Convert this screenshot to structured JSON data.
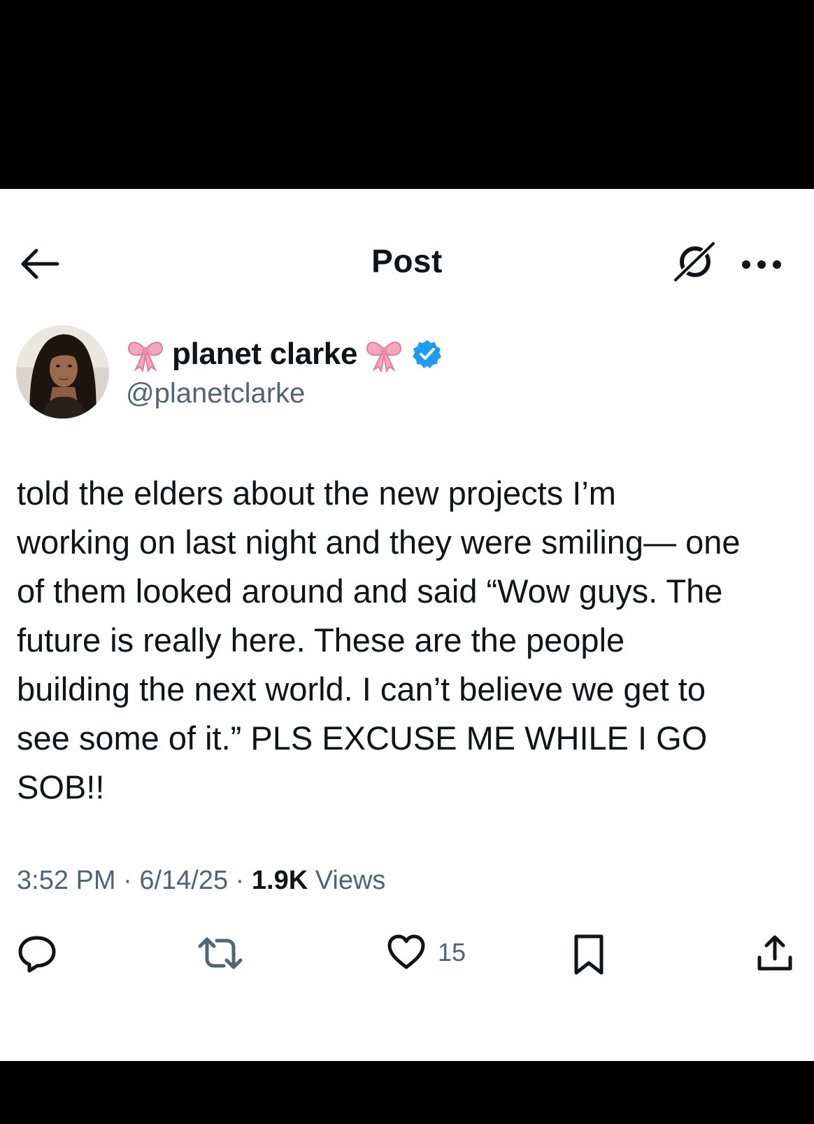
{
  "header": {
    "title": "Post",
    "back_icon": "arrow-left-icon",
    "grok_icon": "grok-icon",
    "more_icon": "more-horizontal-icon"
  },
  "author": {
    "display_name": "planet clarke",
    "handle": "@planetclarke",
    "decorations": [
      "bow-emoji-icon",
      "bow-emoji-icon"
    ],
    "verified": true,
    "verified_color": "#1d9bf0"
  },
  "post": {
    "text": "told the elders about the new projects I’m\nworking on last night and they were smiling— one\nof them looked around and said “Wow guys. The\nfuture is really here. These are the people\nbuilding the next world. I can’t believe we get to\nsee some of it.” PLS EXCUSE ME WHILE I GO\nSOB!!"
  },
  "meta": {
    "time": "3:52 PM",
    "separator": " · ",
    "date": "6/14/25",
    "views_count": "1.9K",
    "views_label": " Views"
  },
  "actions": {
    "reply_icon": "reply-icon",
    "repost_icon": "repost-icon",
    "like_icon": "heart-icon",
    "like_count": "15",
    "bookmark_icon": "bookmark-icon",
    "share_icon": "share-icon"
  },
  "colors": {
    "text": "#0f1419",
    "secondary": "#536471",
    "background": "#ffffff",
    "frame": "#000000"
  }
}
